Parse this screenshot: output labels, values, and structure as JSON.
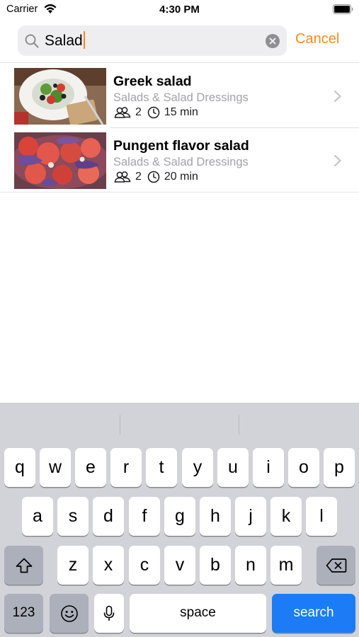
{
  "status_bar": {
    "carrier": "Carrier",
    "time": "4:30 PM"
  },
  "search": {
    "value": "Salad",
    "cancel_label": "Cancel"
  },
  "results": [
    {
      "title": "Greek salad",
      "category": "Salads & Salad Dressings",
      "servings": "2",
      "time": "15 min"
    },
    {
      "title": "Pungent flavor salad",
      "category": "Salads & Salad Dressings",
      "servings": "2",
      "time": "20 min"
    }
  ],
  "keyboard": {
    "row1": [
      "q",
      "w",
      "e",
      "r",
      "t",
      "y",
      "u",
      "i",
      "o",
      "p"
    ],
    "row2": [
      "a",
      "s",
      "d",
      "f",
      "g",
      "h",
      "j",
      "k",
      "l"
    ],
    "row3": [
      "z",
      "x",
      "c",
      "v",
      "b",
      "n",
      "m"
    ],
    "numbers_label": "123",
    "space_label": "space",
    "search_label": "search"
  },
  "colors": {
    "accent": "#ff8a1f",
    "keyboard_bg": "#d1d3d9",
    "search_key": "#1b7cf6"
  },
  "icons": [
    "wifi-icon",
    "battery-icon",
    "search-icon",
    "clear-icon",
    "servings-icon",
    "clock-icon",
    "chevron-right-icon",
    "shift-icon",
    "delete-icon",
    "emoji-icon",
    "microphone-icon"
  ]
}
